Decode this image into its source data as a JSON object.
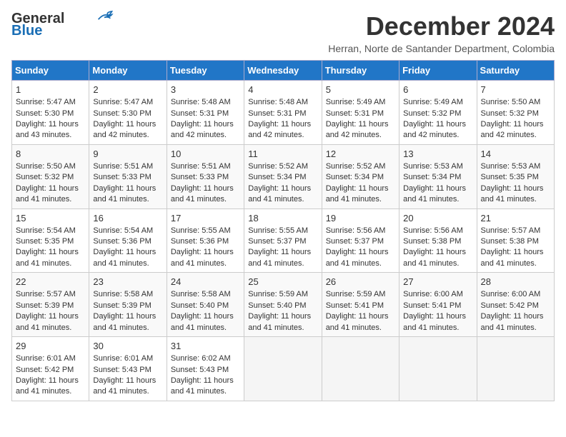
{
  "logo": {
    "line1": "General",
    "line2": "Blue"
  },
  "title": "December 2024",
  "location": "Herran, Norte de Santander Department, Colombia",
  "days_of_week": [
    "Sunday",
    "Monday",
    "Tuesday",
    "Wednesday",
    "Thursday",
    "Friday",
    "Saturday"
  ],
  "weeks": [
    [
      {
        "day": 1,
        "sunrise": "5:47 AM",
        "sunset": "5:30 PM",
        "hours": "11",
        "minutes": "43"
      },
      {
        "day": 2,
        "sunrise": "5:47 AM",
        "sunset": "5:30 PM",
        "hours": "11",
        "minutes": "42"
      },
      {
        "day": 3,
        "sunrise": "5:48 AM",
        "sunset": "5:31 PM",
        "hours": "11",
        "minutes": "42"
      },
      {
        "day": 4,
        "sunrise": "5:48 AM",
        "sunset": "5:31 PM",
        "hours": "11",
        "minutes": "42"
      },
      {
        "day": 5,
        "sunrise": "5:49 AM",
        "sunset": "5:31 PM",
        "hours": "11",
        "minutes": "42"
      },
      {
        "day": 6,
        "sunrise": "5:49 AM",
        "sunset": "5:32 PM",
        "hours": "11",
        "minutes": "42"
      },
      {
        "day": 7,
        "sunrise": "5:50 AM",
        "sunset": "5:32 PM",
        "hours": "11",
        "minutes": "42"
      }
    ],
    [
      {
        "day": 8,
        "sunrise": "5:50 AM",
        "sunset": "5:32 PM",
        "hours": "11",
        "minutes": "41"
      },
      {
        "day": 9,
        "sunrise": "5:51 AM",
        "sunset": "5:33 PM",
        "hours": "11",
        "minutes": "41"
      },
      {
        "day": 10,
        "sunrise": "5:51 AM",
        "sunset": "5:33 PM",
        "hours": "11",
        "minutes": "41"
      },
      {
        "day": 11,
        "sunrise": "5:52 AM",
        "sunset": "5:34 PM",
        "hours": "11",
        "minutes": "41"
      },
      {
        "day": 12,
        "sunrise": "5:52 AM",
        "sunset": "5:34 PM",
        "hours": "11",
        "minutes": "41"
      },
      {
        "day": 13,
        "sunrise": "5:53 AM",
        "sunset": "5:34 PM",
        "hours": "11",
        "minutes": "41"
      },
      {
        "day": 14,
        "sunrise": "5:53 AM",
        "sunset": "5:35 PM",
        "hours": "11",
        "minutes": "41"
      }
    ],
    [
      {
        "day": 15,
        "sunrise": "5:54 AM",
        "sunset": "5:35 PM",
        "hours": "11",
        "minutes": "41"
      },
      {
        "day": 16,
        "sunrise": "5:54 AM",
        "sunset": "5:36 PM",
        "hours": "11",
        "minutes": "41"
      },
      {
        "day": 17,
        "sunrise": "5:55 AM",
        "sunset": "5:36 PM",
        "hours": "11",
        "minutes": "41"
      },
      {
        "day": 18,
        "sunrise": "5:55 AM",
        "sunset": "5:37 PM",
        "hours": "11",
        "minutes": "41"
      },
      {
        "day": 19,
        "sunrise": "5:56 AM",
        "sunset": "5:37 PM",
        "hours": "11",
        "minutes": "41"
      },
      {
        "day": 20,
        "sunrise": "5:56 AM",
        "sunset": "5:38 PM",
        "hours": "11",
        "minutes": "41"
      },
      {
        "day": 21,
        "sunrise": "5:57 AM",
        "sunset": "5:38 PM",
        "hours": "11",
        "minutes": "41"
      }
    ],
    [
      {
        "day": 22,
        "sunrise": "5:57 AM",
        "sunset": "5:39 PM",
        "hours": "11",
        "minutes": "41"
      },
      {
        "day": 23,
        "sunrise": "5:58 AM",
        "sunset": "5:39 PM",
        "hours": "11",
        "minutes": "41"
      },
      {
        "day": 24,
        "sunrise": "5:58 AM",
        "sunset": "5:40 PM",
        "hours": "11",
        "minutes": "41"
      },
      {
        "day": 25,
        "sunrise": "5:59 AM",
        "sunset": "5:40 PM",
        "hours": "11",
        "minutes": "41"
      },
      {
        "day": 26,
        "sunrise": "5:59 AM",
        "sunset": "5:41 PM",
        "hours": "11",
        "minutes": "41"
      },
      {
        "day": 27,
        "sunrise": "6:00 AM",
        "sunset": "5:41 PM",
        "hours": "11",
        "minutes": "41"
      },
      {
        "day": 28,
        "sunrise": "6:00 AM",
        "sunset": "5:42 PM",
        "hours": "11",
        "minutes": "41"
      }
    ],
    [
      {
        "day": 29,
        "sunrise": "6:01 AM",
        "sunset": "5:42 PM",
        "hours": "11",
        "minutes": "41"
      },
      {
        "day": 30,
        "sunrise": "6:01 AM",
        "sunset": "5:43 PM",
        "hours": "11",
        "minutes": "41"
      },
      {
        "day": 31,
        "sunrise": "6:02 AM",
        "sunset": "5:43 PM",
        "hours": "11",
        "minutes": "41"
      },
      null,
      null,
      null,
      null
    ]
  ]
}
